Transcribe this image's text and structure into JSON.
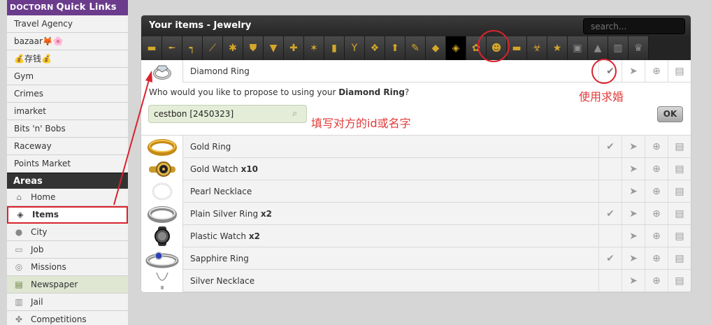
{
  "sidebar": {
    "header_logo": "DOCTORN",
    "header_title": "Quick Links",
    "quick_links": [
      "Travel Agency",
      "bazaar🦊🌸",
      "💰存钱💰",
      "Gym",
      "Crimes",
      "imarket",
      "Bits 'n' Bobs",
      "Raceway",
      "Points Market"
    ],
    "areas_title": "Areas",
    "areas": [
      {
        "label": "Home",
        "icon": "home-icon",
        "glyph": "⌂"
      },
      {
        "label": "Items",
        "icon": "cube-icon",
        "glyph": "◈"
      },
      {
        "label": "City",
        "icon": "map-pin-icon",
        "glyph": "●"
      },
      {
        "label": "Job",
        "icon": "briefcase-icon",
        "glyph": "▭"
      },
      {
        "label": "Missions",
        "icon": "target-icon",
        "glyph": "◎"
      },
      {
        "label": "Newspaper",
        "icon": "newspaper-icon",
        "glyph": "▤"
      },
      {
        "label": "Jail",
        "icon": "jail-bars-icon",
        "glyph": "▥"
      },
      {
        "label": "Competitions",
        "icon": "trophy-icon",
        "glyph": "✤"
      }
    ]
  },
  "panel": {
    "title": "Your items - Jewelry",
    "search_placeholder": "search...",
    "categories": [
      {
        "icon": "folder-icon",
        "glyph": "▬"
      },
      {
        "icon": "rifle-icon",
        "glyph": "╾"
      },
      {
        "icon": "pistol-icon",
        "glyph": "┑"
      },
      {
        "icon": "blade-icon",
        "glyph": "⟋"
      },
      {
        "icon": "grenade-icon",
        "glyph": "✱"
      },
      {
        "icon": "armor-icon",
        "glyph": "⛊"
      },
      {
        "icon": "clothing-icon",
        "glyph": "▼"
      },
      {
        "icon": "medical-icon",
        "glyph": "✚"
      },
      {
        "icon": "drug-leaf-icon",
        "glyph": "✶"
      },
      {
        "icon": "energy-drink-icon",
        "glyph": "▮"
      },
      {
        "icon": "alcohol-icon",
        "glyph": "Y"
      },
      {
        "icon": "candy-icon",
        "glyph": "❖"
      },
      {
        "icon": "booster-icon",
        "glyph": "⬆"
      },
      {
        "icon": "enhancer-icon",
        "glyph": "✎"
      },
      {
        "icon": "supply-pack-icon",
        "glyph": "◆"
      },
      {
        "icon": "jewelry-diamond-icon",
        "glyph": "◈"
      },
      {
        "icon": "flower-icon",
        "glyph": "✿"
      },
      {
        "icon": "plushie-icon",
        "glyph": "☻"
      },
      {
        "icon": "car-icon",
        "glyph": "▬"
      },
      {
        "icon": "virus-icon",
        "glyph": "☣"
      },
      {
        "icon": "special-star-icon",
        "glyph": "★"
      },
      {
        "icon": "lock-icon",
        "glyph": "▣"
      },
      {
        "icon": "pyramid-icon",
        "glyph": "▲"
      },
      {
        "icon": "stats-icon",
        "glyph": "▥"
      },
      {
        "icon": "trophy-icon",
        "glyph": "♛"
      }
    ],
    "selected_item": {
      "name": "Diamond Ring",
      "thumb": "diamond-ring"
    },
    "propose_prefix": "Who would you like to propose to using your ",
    "propose_item": "Diamond Ring",
    "propose_suffix": "?",
    "propose_input_value": "cestbon [2450323]",
    "ok_label": "OK",
    "items": [
      {
        "name": "Gold Ring",
        "qty": "",
        "thumb": "gold-ring",
        "usable": true
      },
      {
        "name": "Gold Watch",
        "qty": "x10",
        "thumb": "gold-watch",
        "usable": false
      },
      {
        "name": "Pearl Necklace",
        "qty": "",
        "thumb": "pearl-necklace",
        "usable": false
      },
      {
        "name": "Plain Silver Ring",
        "qty": "x2",
        "thumb": "silver-ring",
        "usable": true
      },
      {
        "name": "Plastic Watch",
        "qty": "x2",
        "thumb": "plastic-watch",
        "usable": false
      },
      {
        "name": "Sapphire Ring",
        "qty": "",
        "thumb": "sapphire-ring",
        "usable": true
      },
      {
        "name": "Silver Necklace",
        "qty": "",
        "thumb": "silver-necklace",
        "usable": false
      }
    ]
  },
  "annotations": {
    "use_propose": "使用求婚",
    "fill_id": "填写对方的id或名字"
  },
  "colors": {
    "annotation_red": "#d9232e",
    "torn_purple": "#6b3b8c",
    "category_gold": "#d4a62a"
  }
}
